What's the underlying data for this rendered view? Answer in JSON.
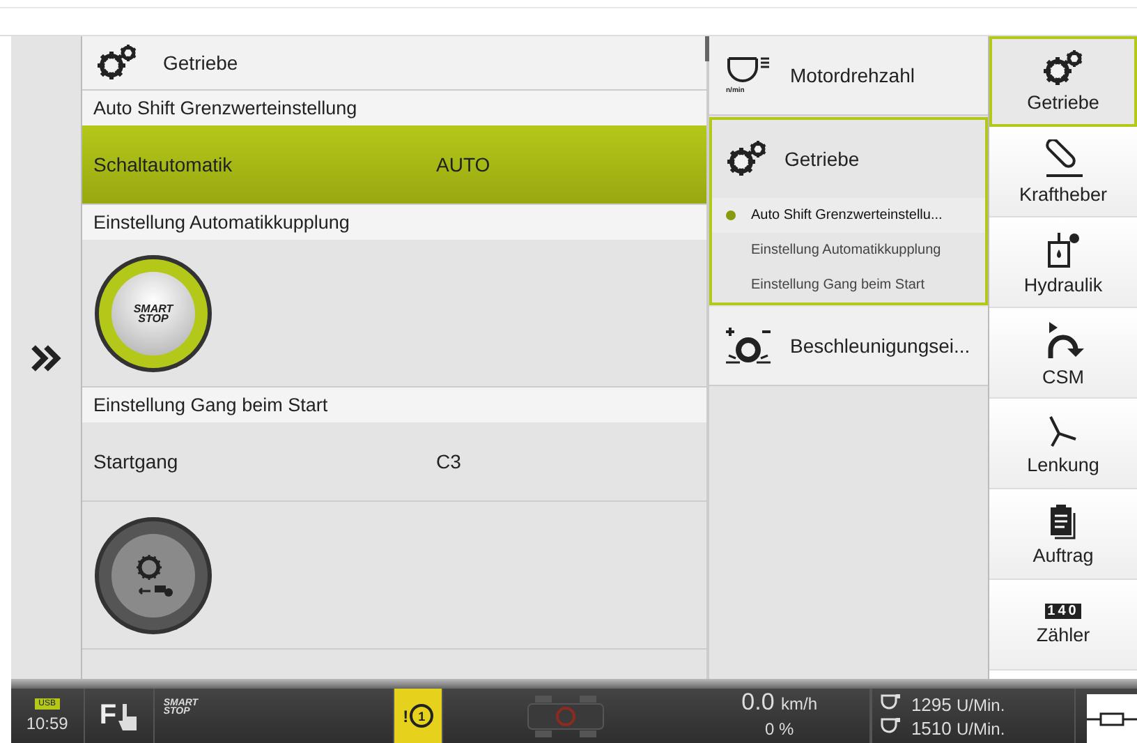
{
  "header": {
    "title": "Getriebe"
  },
  "sections": [
    {
      "title": "Auto Shift Grenzwerteinstellung",
      "rows": [
        {
          "kind": "setting",
          "label": "Schaltautomatik",
          "value": "AUTO",
          "selected": true
        }
      ]
    },
    {
      "title": "Einstellung Automatikkupplung",
      "rows": [
        {
          "kind": "smartstop",
          "label": "SMART STOP",
          "on": true
        }
      ]
    },
    {
      "title": "Einstellung Gang beim Start",
      "rows": [
        {
          "kind": "setting",
          "label": "Startgang",
          "value": "C3",
          "selected": false
        },
        {
          "kind": "gearstart",
          "on": false
        }
      ]
    }
  ],
  "submenu": [
    {
      "kind": "engine",
      "label": "Motordrehzahl",
      "unit": "n/min",
      "selected": false
    },
    {
      "kind": "gears",
      "label": "Getriebe",
      "selected": true,
      "children": [
        {
          "label": "Auto Shift Grenzwerteinstellu...",
          "selected": true
        },
        {
          "label": "Einstellung Automatikkupplung",
          "selected": false
        },
        {
          "label": "Einstellung Gang beim Start",
          "selected": false
        }
      ]
    },
    {
      "kind": "accel",
      "label": "Beschleunigungsei...",
      "selected": false
    }
  ],
  "nav": [
    {
      "kind": "gears",
      "label": "Getriebe",
      "selected": true
    },
    {
      "kind": "lift",
      "label": "Kraftheber",
      "selected": false
    },
    {
      "kind": "hydraulic",
      "label": "Hydraulik",
      "selected": false
    },
    {
      "kind": "csm",
      "label": "CSM",
      "selected": false
    },
    {
      "kind": "steering",
      "label": "Lenkung",
      "selected": false
    },
    {
      "kind": "job",
      "label": "Auftrag",
      "selected": false
    },
    {
      "kind": "counter",
      "label": "Zähler",
      "digits": "140",
      "selected": false
    }
  ],
  "status_bar": {
    "usb": "USB",
    "time": "10:59",
    "function_key": "F",
    "smart_stop": "SMART STOP",
    "warning": "!",
    "warning_number": "1",
    "speed": "0.0",
    "speed_unit": "km/h",
    "slip": "0 %",
    "rpm": [
      {
        "value": "1295",
        "unit": "U/Min."
      },
      {
        "value": "1510",
        "unit": "U/Min."
      }
    ]
  }
}
